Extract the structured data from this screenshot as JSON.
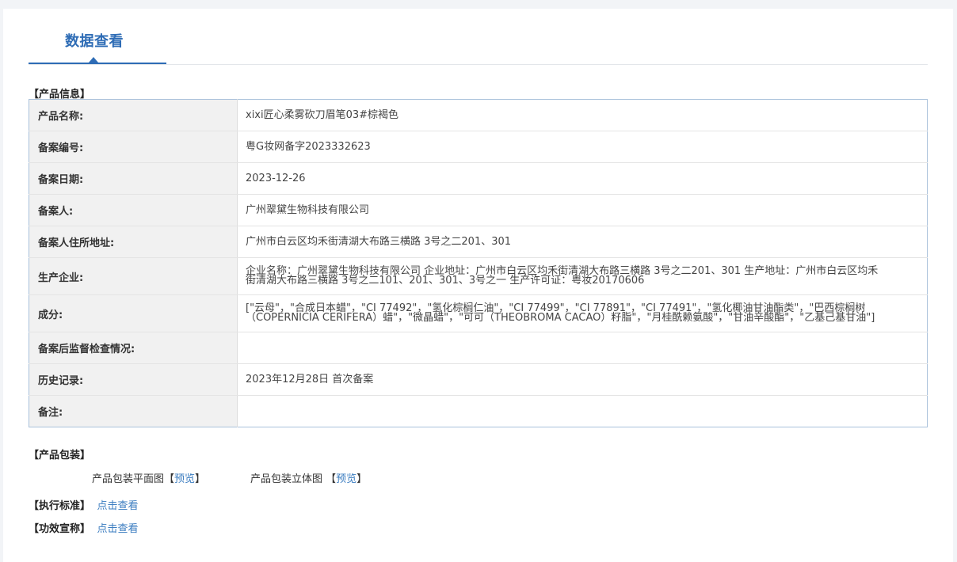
{
  "tab": {
    "label": "数据查看"
  },
  "product_info": {
    "title": "【产品信息】",
    "rows": [
      {
        "label": "产品名称:",
        "value": "xixi匠心柔雾砍刀眉笔03#棕褐色"
      },
      {
        "label": "备案编号:",
        "value": "粤G妆网备字2023332623"
      },
      {
        "label": "备案日期:",
        "value": "2023-12-26"
      },
      {
        "label": "备案人:",
        "value": "广州翠黛生物科技有限公司"
      },
      {
        "label": "备案人住所地址:",
        "value": "广州市白云区均禾街清湖大布路三横路 3号之二201、301"
      },
      {
        "label": "生产企业:",
        "value": "企业名称：广州翠黛生物科技有限公司 企业地址：广州市白云区均禾街清湖大布路三横路 3号之二201、301 生产地址：广州市白云区均禾街清湖大布路三横路 3号之二101、201、301、3号之一 生产许可证：粤妆20170606"
      },
      {
        "label": "成分:",
        "value": "[\"云母\"，\"合成日本蜡\"，\"CI 77492\"，\"氢化棕榈仁油\"，\"CI 77499\"，\"CI 77891\"，\"CI 77491\"，\"氢化椰油甘油酯类\"，\"巴西棕榈树（COPERNICIA CERIFERA）蜡\"，\"微晶蜡\"，\"可可（THEOBROMA CACAO）籽脂\"，\"月桂酰赖氨酸\"，\"甘油辛酸酯\"，\"乙基己基甘油\"]"
      },
      {
        "label": "备案后监督检查情况:",
        "value": ""
      },
      {
        "label": "历史记录:",
        "value": "2023年12月28日 首次备案"
      },
      {
        "label": "备注:",
        "value": ""
      }
    ]
  },
  "packaging": {
    "title": "【产品包装】",
    "flat_label": "产品包装平面图",
    "solid_label": "产品包装立体图 ",
    "bracket_open": "【",
    "bracket_close": "】",
    "preview_link": "预览"
  },
  "standard": {
    "title": "【执行标准】",
    "link": "点击查看"
  },
  "efficacy": {
    "title": "【功效宣称】",
    "link": "点击查看"
  }
}
